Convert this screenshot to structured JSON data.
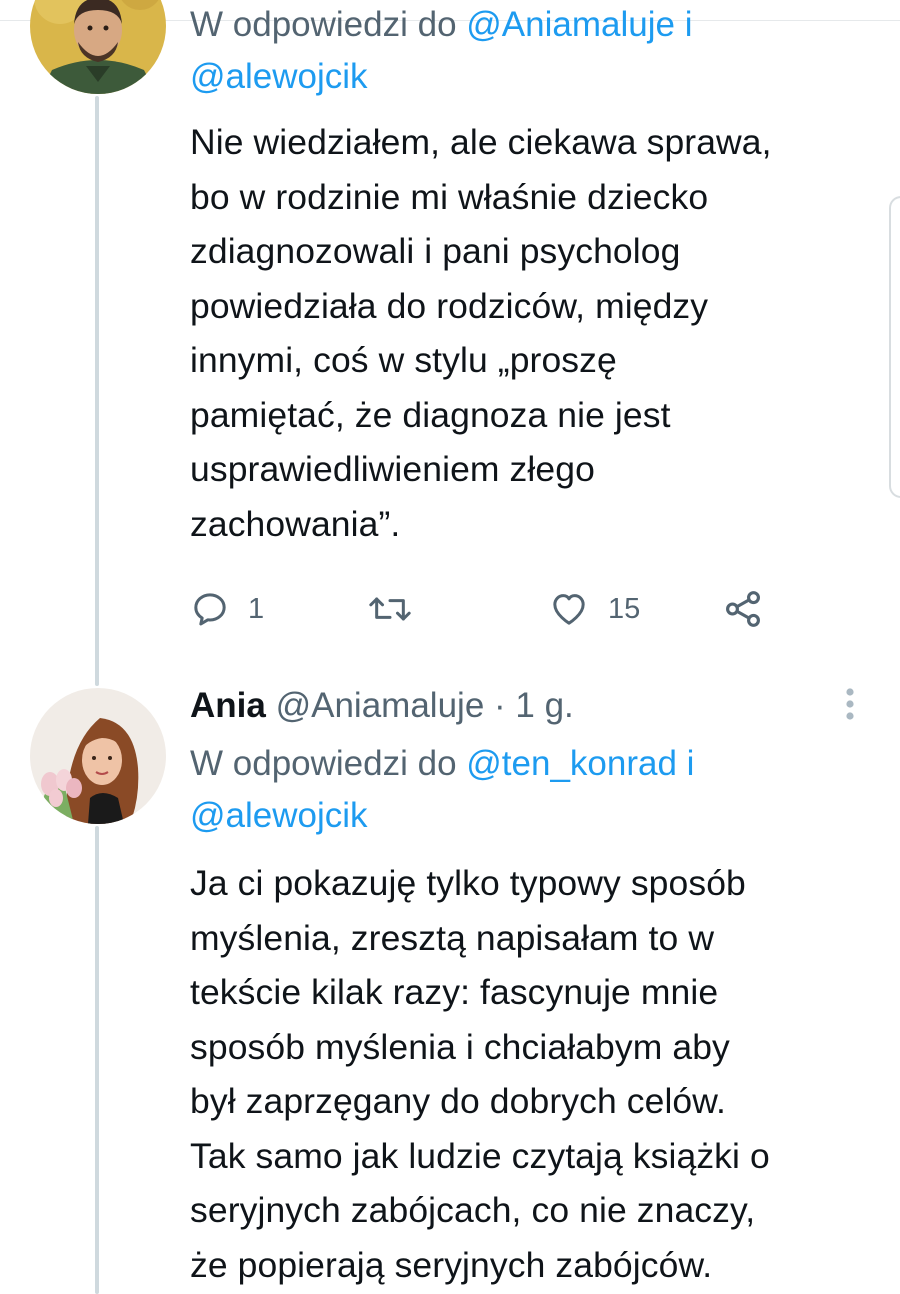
{
  "tweets": [
    {
      "reply_prefix": "W odpowiedzi do",
      "mention_1": "@Aniamaluje i",
      "mention_2": "@alewojcik",
      "lines": [
        "Nie wiedziałem, ale ciekawa sprawa,",
        "bo w rodzinie mi właśnie dziecko",
        "zdiagnozowali i pani psycholog",
        "powiedziała do rodziców, między",
        "innymi, coś w stylu „proszę",
        "pamiętać, że diagnoza nie jest",
        "usprawiedliwieniem złego",
        "zachowania”."
      ],
      "actions": {
        "reply_count": "1",
        "retweet_count": "",
        "like_count": "15"
      }
    },
    {
      "name": "Ania",
      "handle": "@Aniamaluje",
      "separator": "·",
      "time": "1 g.",
      "reply_prefix": "W odpowiedzi do",
      "mention_1": "@ten_konrad i",
      "mention_2": "@alewojcik",
      "lines": [
        "Ja ci pokazuję tylko typowy sposób",
        "myślenia, zresztą napisałam to w",
        "tekście kilak razy: fascynuje mnie",
        "sposób myślenia i chciałabym aby",
        "był zaprzęgany do dobrych celów.",
        "Tak samo jak ludzie czytają książki o",
        "seryjnych zabójcach, co nie znaczy,",
        "że popierają seryjnych zabójców."
      ]
    }
  ],
  "colors": {
    "link": "#1d9bf0",
    "secondary_text": "#536471",
    "primary_text": "#0f1419",
    "thread_line": "#cfd9de"
  },
  "icons": {
    "reply": "reply-icon",
    "retweet": "retweet-icon",
    "like": "heart-icon",
    "share": "share-icon",
    "more": "more-vertical-icon"
  }
}
